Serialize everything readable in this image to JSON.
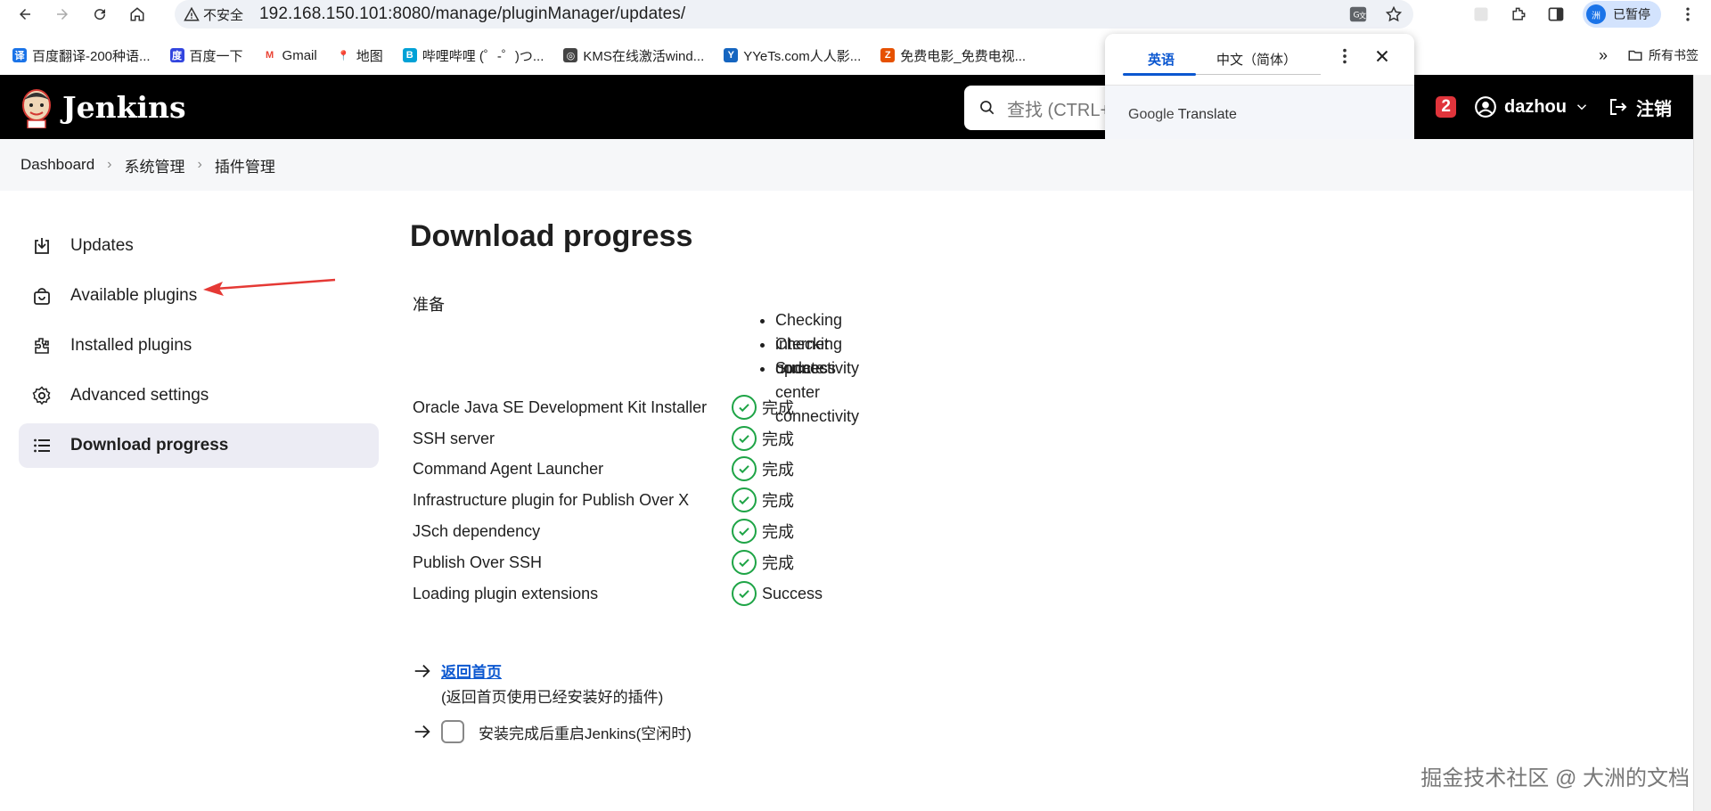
{
  "browser": {
    "security_label": "不安全",
    "url": "192.168.150.101:8080/manage/pluginManager/updates/",
    "profile_label": "已暂停",
    "profile_initial": "洲"
  },
  "bookmarks": {
    "items": [
      {
        "label": "百度翻译-200种语...",
        "fav": "译",
        "color": "#1a73e8"
      },
      {
        "label": "百度一下",
        "fav": "度",
        "color": "#3245df"
      },
      {
        "label": "Gmail",
        "fav": "M",
        "color": "#ea4335"
      },
      {
        "label": "地图",
        "fav": "📍",
        "color": "#34a853"
      },
      {
        "label": "哔哩哔哩 (゜-゜)つ...",
        "fav": "B",
        "color": "#00a1d6"
      },
      {
        "label": "KMS在线激活wind...",
        "fav": "◎",
        "color": "#444444"
      },
      {
        "label": "YYeTs.com人人影...",
        "fav": "Y",
        "color": "#1565c0"
      },
      {
        "label": "免费电影_免费电视...",
        "fav": "Z",
        "color": "#e65100"
      }
    ],
    "all_bookmarks": "所有书签"
  },
  "translate": {
    "tab_en": "英语",
    "tab_zh": "中文（简体）",
    "brand_google": "Google",
    "brand_translate": "Translate"
  },
  "jenkins": {
    "name": "Jenkins",
    "search_placeholder": "查找 (CTRL+",
    "notification_count": "2",
    "user": "dazhou",
    "logout": "注销"
  },
  "breadcrumb": [
    "Dashboard",
    "系统管理",
    "插件管理"
  ],
  "sidebar": {
    "items": [
      {
        "label": "Updates",
        "icon": "download-icon"
      },
      {
        "label": "Available plugins",
        "icon": "shopping-bag-icon"
      },
      {
        "label": "Installed plugins",
        "icon": "puzzle-icon"
      },
      {
        "label": "Advanced settings",
        "icon": "gear-icon"
      },
      {
        "label": "Download progress",
        "icon": "list-icon",
        "active": true
      }
    ]
  },
  "main": {
    "title": "Download progress",
    "prep_label": "准备",
    "checks": [
      "Checking internet connectivity",
      "Checking update center connectivity",
      "Success"
    ],
    "jobs": [
      {
        "name": "Oracle Java SE Development Kit Installer",
        "status": "完成"
      },
      {
        "name": "SSH server",
        "status": "完成"
      },
      {
        "name": "Command Agent Launcher",
        "status": "完成"
      },
      {
        "name": "Infrastructure plugin for Publish Over X",
        "status": "完成"
      },
      {
        "name": "JSch dependency",
        "status": "完成"
      },
      {
        "name": "Publish Over SSH",
        "status": "完成"
      },
      {
        "name": "Loading plugin extensions",
        "status": "Success"
      }
    ],
    "back_link": "返回首页",
    "back_sub": "(返回首页使用已经安装好的插件)",
    "restart_label": "安装完成后重启Jenkins(空闲时)"
  },
  "watermark": "掘金技术社区 @ 大洲的文档",
  "colors": {
    "accent": "#0b57d0",
    "success": "#1ea446",
    "badge": "#e0343b",
    "header": "#000000"
  }
}
